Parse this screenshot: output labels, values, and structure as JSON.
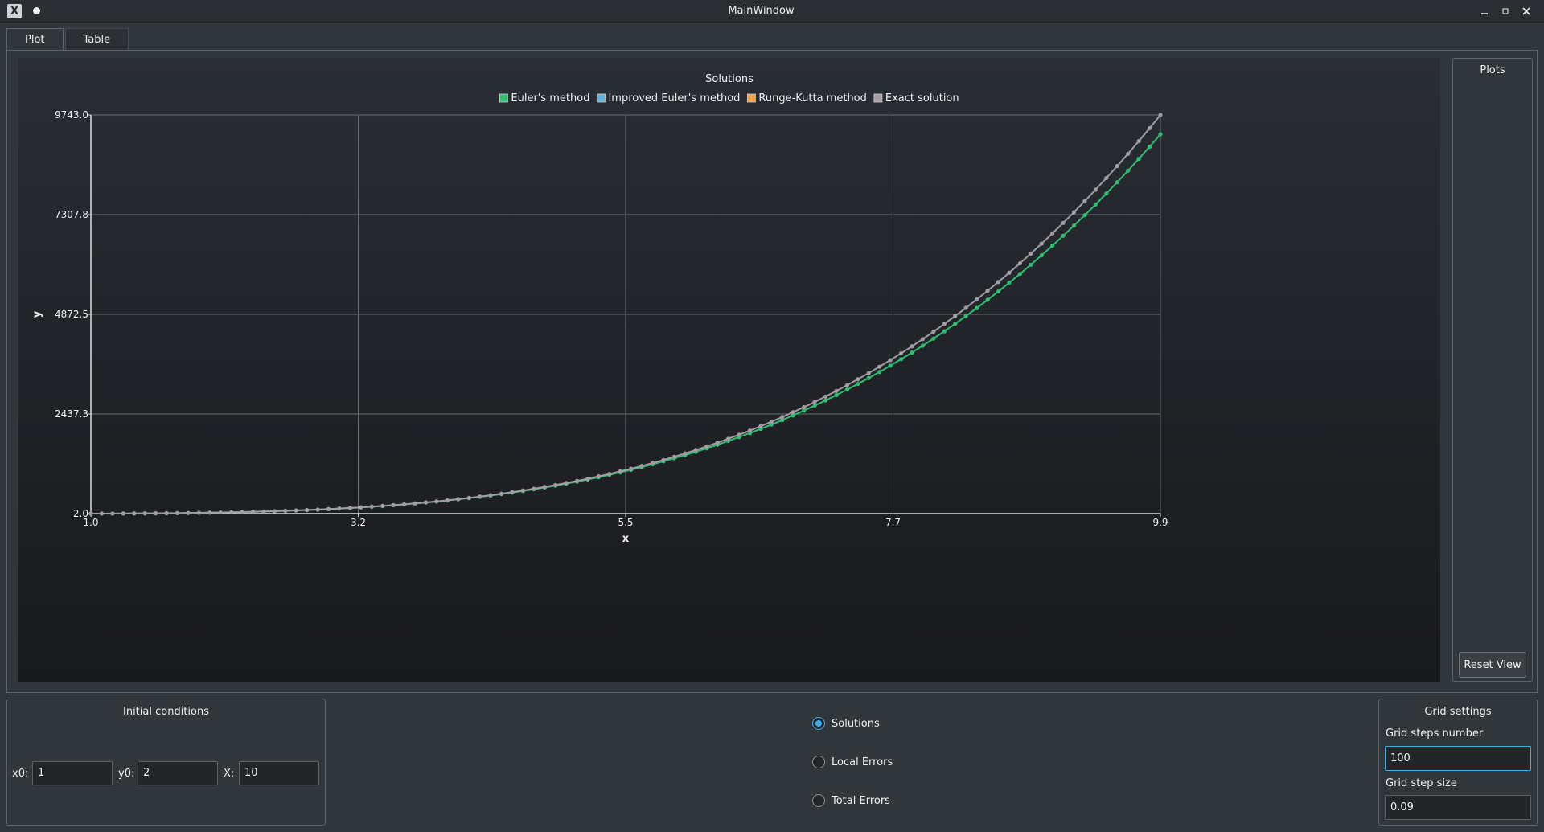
{
  "window": {
    "title": "MainWindow"
  },
  "tabs": [
    {
      "label": "Plot",
      "active": true
    },
    {
      "label": "Table",
      "active": false
    }
  ],
  "plots_panel": {
    "title": "Plots",
    "reset_label": "Reset View"
  },
  "initial_conditions": {
    "title": "Initial conditions",
    "x0_label": "x0:",
    "x0_value": "1",
    "y0_label": "y0:",
    "y0_value": "2",
    "X_label": "X:",
    "X_value": "10"
  },
  "mode": {
    "options": [
      {
        "label": "Solutions",
        "checked": true
      },
      {
        "label": "Local Errors",
        "checked": false
      },
      {
        "label": "Total Errors",
        "checked": false
      }
    ]
  },
  "grid_settings": {
    "title": "Grid settings",
    "steps_label": "Grid steps number",
    "steps_value": "100",
    "size_label": "Grid step size",
    "size_value": "0.09"
  },
  "chart_data": {
    "type": "line",
    "title": "Solutions",
    "xlabel": "x",
    "ylabel": "y",
    "xlim": [
      1.0,
      9.9
    ],
    "ylim": [
      2.0,
      9743.0
    ],
    "x_ticks": [
      "1.0",
      "3.2",
      "5.5",
      "7.7",
      "9.9"
    ],
    "y_ticks": [
      "2.0",
      "2437.3",
      "4872.5",
      "7307.8",
      "9743.0"
    ],
    "grid": true,
    "legend_position": "top-center",
    "x_start": 1.0,
    "x_step": 0.09,
    "n_points": 100,
    "series": [
      {
        "name": "Euler's method",
        "color": "#2fbf71",
        "visible": true,
        "end_value": 9270
      },
      {
        "name": "Improved Euler's method",
        "color": "#5fb3d6",
        "visible": false
      },
      {
        "name": "Runge-Kutta method",
        "color": "#f0a14a",
        "visible": false
      },
      {
        "name": "Exact solution",
        "color": "#a19da3",
        "visible": true,
        "end_value": 9743
      }
    ]
  }
}
